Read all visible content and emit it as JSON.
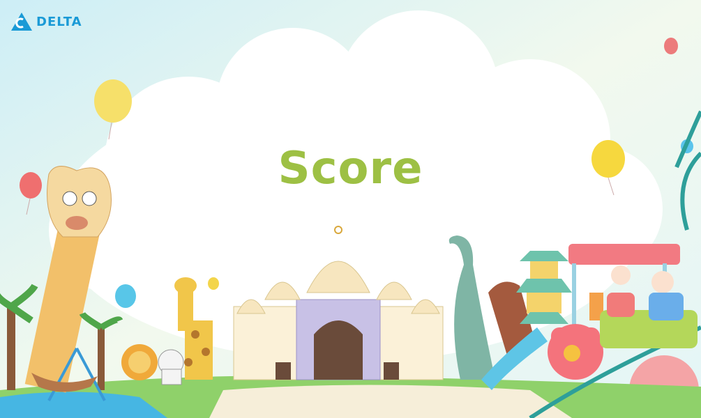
{
  "brand": {
    "name": "DELTA",
    "logo_icon": "delta-triangle-logo",
    "color": "#1a9ad6"
  },
  "title": {
    "text": "Score",
    "color": "#9dc044"
  },
  "scene": {
    "theme": "amusement-park",
    "elements": [
      "cloud",
      "balloons",
      "tiki-tower",
      "pirate-ship-ride",
      "palm-trees",
      "lion",
      "white-tiger",
      "giraffe",
      "palace",
      "dinosaur",
      "water-slide",
      "pagoda",
      "roller-coaster-train",
      "family-riders"
    ]
  }
}
